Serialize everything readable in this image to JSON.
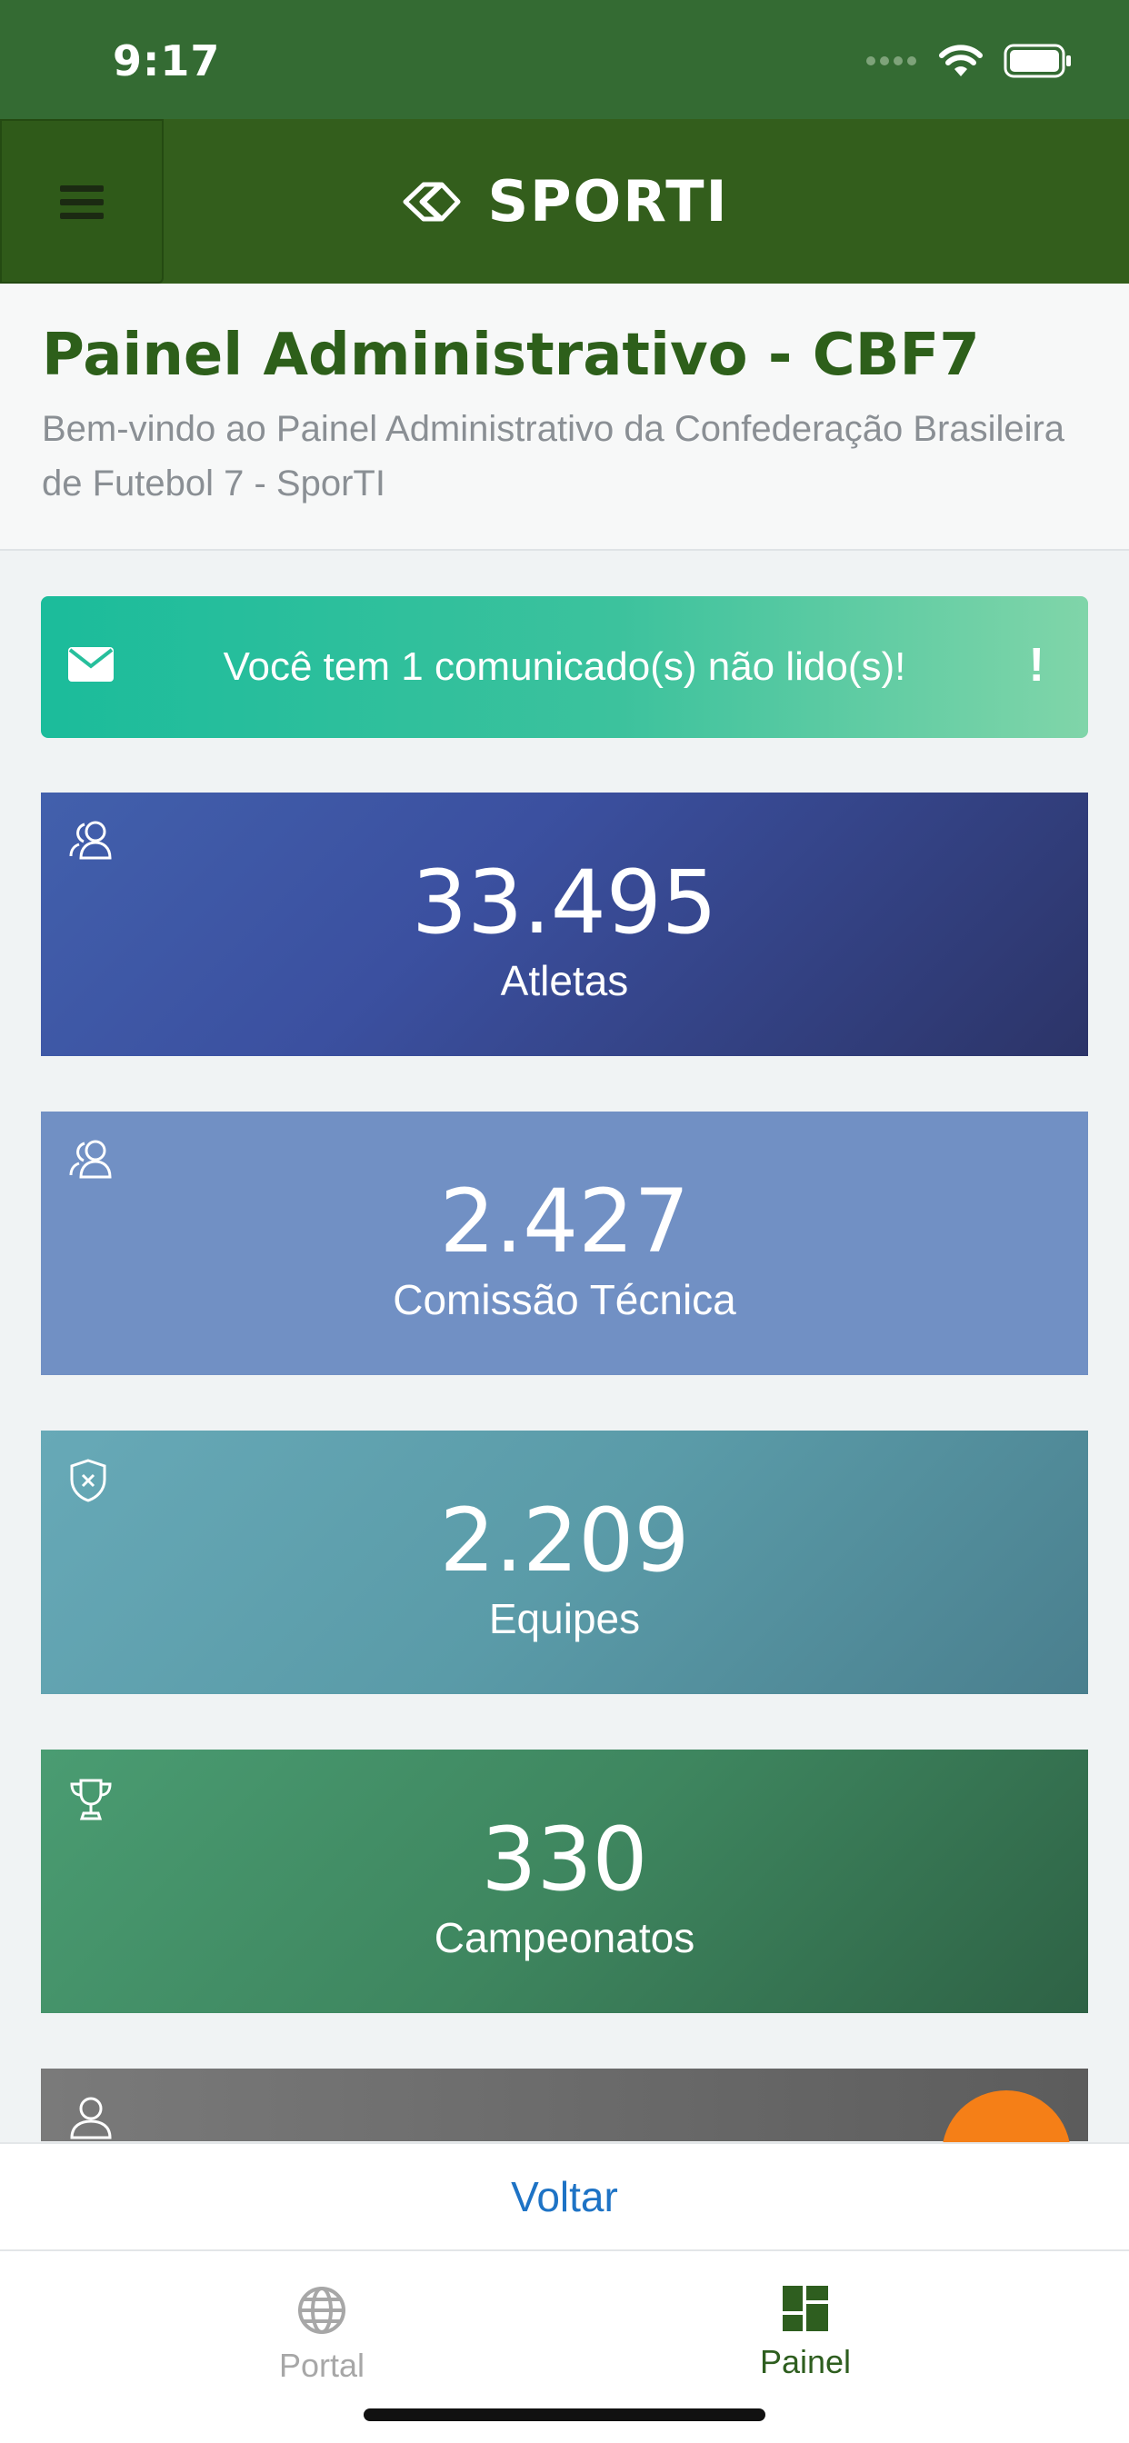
{
  "status_bar": {
    "time": "9:17"
  },
  "navbar": {
    "brand": "SPORTI"
  },
  "header": {
    "title": "Painel Administrativo - CBF7",
    "subtitle": "Bem-vindo ao Painel Administrativo da Confederação Brasileira de Futebol 7 - SporTI"
  },
  "alert": {
    "text": "Você tem 1 comunicado(s) não lido(s)!",
    "badge": "!"
  },
  "cards": [
    {
      "value": "33.495",
      "label": "Atletas",
      "icon": "users-icon"
    },
    {
      "value": "2.427",
      "label": "Comissão Técnica",
      "icon": "users-icon"
    },
    {
      "value": "2.209",
      "label": "Equipes",
      "icon": "shield-icon"
    },
    {
      "value": "330",
      "label": "Campeonatos",
      "icon": "trophy-icon"
    },
    {
      "icon": "user-icon"
    }
  ],
  "back_bar": {
    "label": "Voltar"
  },
  "tabs": [
    {
      "label": "Portal",
      "icon": "globe-icon"
    },
    {
      "label": "Painel",
      "icon": "dashboard-icon"
    }
  ],
  "colors": {
    "navbar": "#335e1c",
    "title": "#2d5f1a",
    "link": "#1e73c5",
    "fab": "#f57f17"
  }
}
